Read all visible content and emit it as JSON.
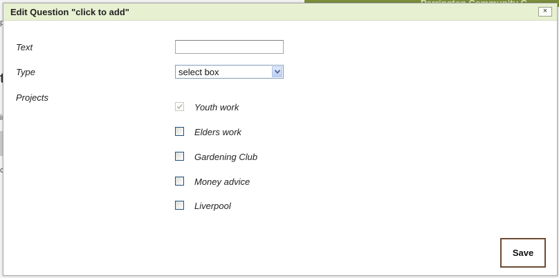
{
  "background": {
    "banner_text": "Parrington Community C",
    "fragments": [
      "p",
      "t",
      "in",
      "c"
    ]
  },
  "dialog": {
    "title": "Edit Question \"click to add\"",
    "close_label": "×",
    "save_label": "Save"
  },
  "form": {
    "text": {
      "label": "Text",
      "value": ""
    },
    "type": {
      "label": "Type",
      "selected": "select box"
    },
    "projects": {
      "label": "Projects",
      "items": [
        {
          "label": "Youth work",
          "checked": true,
          "disabled": true
        },
        {
          "label": "Elders work",
          "checked": false,
          "disabled": false
        },
        {
          "label": "Gardening Club",
          "checked": false,
          "disabled": false
        },
        {
          "label": "Money advice",
          "checked": false,
          "disabled": false
        },
        {
          "label": "Liverpool",
          "checked": false,
          "disabled": false
        }
      ]
    }
  },
  "colors": {
    "titlebar": "#e8f0d2",
    "banner": "#7c8f3c",
    "save_border": "#6b4a32",
    "checkbox_border": "#1c5180"
  },
  "icons": {
    "close": "close-icon",
    "dropdown": "chevron-down-icon",
    "check": "checkmark-icon"
  }
}
